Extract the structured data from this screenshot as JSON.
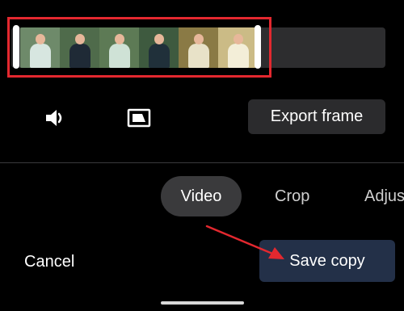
{
  "timeline": {
    "thumbnails": [
      {
        "bg": "#6e8a6a",
        "kit": "#d7e6e0"
      },
      {
        "bg": "#4f6b4b",
        "kit": "#1f2a36"
      },
      {
        "bg": "#5d7a55",
        "kit": "#cfe2d6"
      },
      {
        "bg": "#3e5a3f",
        "kit": "#20303a"
      },
      {
        "bg": "#8a7a45",
        "kit": "#e8e2c8"
      },
      {
        "bg": "#cbbb86",
        "kit": "#f3eed8"
      }
    ]
  },
  "controls": {
    "mute_icon": "speaker-icon",
    "frame_icon": "frame-icon",
    "export_label": "Export frame"
  },
  "tabs": {
    "video": "Video",
    "crop": "Crop",
    "adjust": "Adjus"
  },
  "actions": {
    "cancel_label": "Cancel",
    "save_label": "Save copy"
  },
  "colors": {
    "highlight": "#e3282f",
    "save_bg": "#233048"
  }
}
